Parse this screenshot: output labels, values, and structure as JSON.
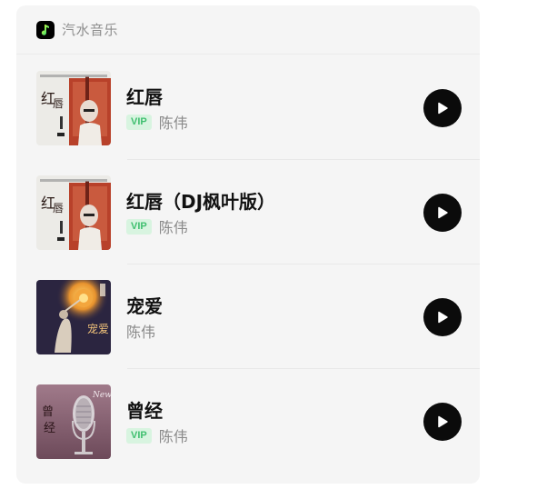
{
  "app": {
    "name": "汽水音乐",
    "logo_icon": "qishui-music-logo-icon"
  },
  "songs": [
    {
      "title": "红唇",
      "vip": "VIP",
      "artist": "陈伟"
    },
    {
      "title": "红唇（DJ枫叶版）",
      "vip": "VIP",
      "artist": "陈伟"
    },
    {
      "title": "宠爱",
      "vip": null,
      "artist": "陈伟"
    },
    {
      "title": "曾经",
      "vip": "VIP",
      "artist": "陈伟"
    }
  ],
  "colors": {
    "card_bg": "#f5f5f5",
    "vip_text": "#3fbf6f",
    "vip_bg": "#d8f4e0",
    "play_button": "#0b0b0b"
  }
}
